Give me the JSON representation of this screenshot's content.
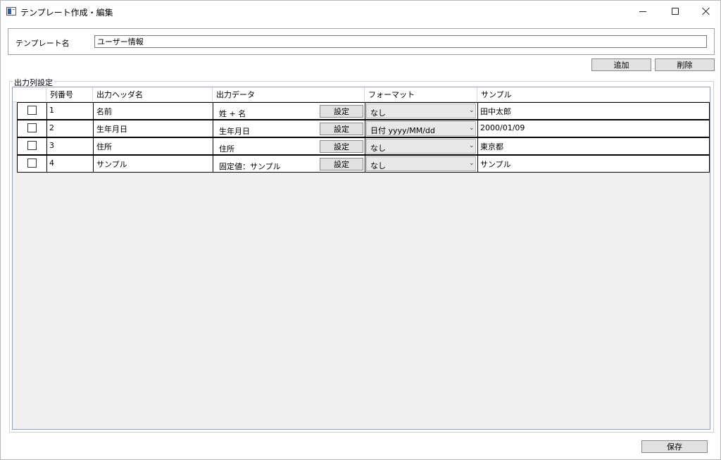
{
  "window": {
    "title": "テンプレート作成・編集",
    "minimize_label": "",
    "maximize_label": "",
    "close_label": ""
  },
  "template_name": {
    "label": "テンプレート名",
    "value": "ユーザー情報"
  },
  "toolbar": {
    "add_label": "追加",
    "delete_label": "削除"
  },
  "output_settings": {
    "group_label": "出力列設定",
    "columns": [
      "",
      "列番号",
      "出力ヘッダ名",
      "出力データ",
      "フォーマット",
      "サンプル"
    ],
    "rows": [
      {
        "checked": false,
        "num": "1",
        "header": "名前",
        "data": "姓 + 名",
        "set_label": "設定",
        "format": "なし",
        "sample": "田中太郎"
      },
      {
        "checked": false,
        "num": "2",
        "header": "生年月日",
        "data": "生年月日",
        "set_label": "設定",
        "format": "日付 yyyy/MM/dd",
        "sample": "2000/01/09"
      },
      {
        "checked": false,
        "num": "3",
        "header": "住所",
        "data": "住所",
        "set_label": "設定",
        "format": "なし",
        "sample": "東京都"
      },
      {
        "checked": false,
        "num": "4",
        "header": "サンプル",
        "data": "固定値：サンプル",
        "set_label": "設定",
        "format": "なし",
        "sample": "サンプル"
      }
    ]
  },
  "footer": {
    "save_label": "保存"
  }
}
